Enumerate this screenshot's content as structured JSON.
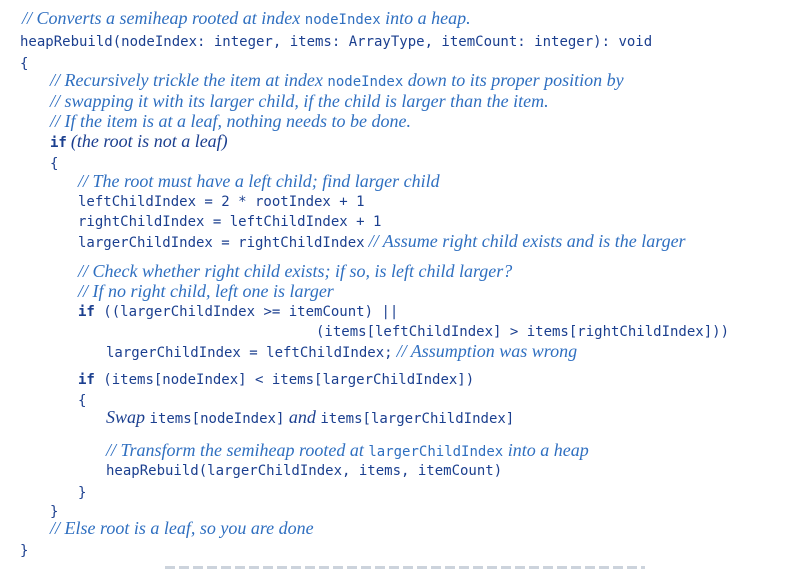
{
  "header_comment": "// Converts a semiheap rooted at index ",
  "header_comment_code": "nodeIndex",
  "header_comment_tail": " into a heap.",
  "signature": "heapRebuild(nodeIndex: integer, items: ArrayType, itemCount: integer): void",
  "open_brace_1": "{",
  "comment_trickle_a": "// Recursively trickle the item at index ",
  "comment_trickle_code": "nodeIndex",
  "comment_trickle_b": " down to its proper position by",
  "comment_swap": "// swapping it with its larger child, if the child is larger than the item.",
  "comment_leaf": "// If the item is at a leaf, nothing needs to be done.",
  "if_kw_1": "if",
  "if_cond_1": "(the root is not a leaf)",
  "open_brace_2": "{",
  "comment_left_child": "// The root must have a left child; find larger child",
  "stmt_left": "leftChildIndex = 2 * rootIndex + 1",
  "stmt_right": "rightChildIndex = leftChildIndex + 1",
  "stmt_larger": "largerChildIndex = rightChildIndex",
  "comment_assume": "// Assume right child exists and is the larger",
  "comment_check_a": "// Check whether right child exists; if so, is left child larger?",
  "comment_check_b": "// If no right child, left one is larger",
  "if_kw_2": "if",
  "if_cond_2a": "((largerChildIndex >= itemCount) ||",
  "if_cond_2b": "(items[leftChildIndex] > items[rightChildIndex]))",
  "stmt_larger_left": "largerChildIndex = leftChildIndex;",
  "comment_wrong": "// Assumption was wrong",
  "if_kw_3": "if",
  "if_cond_3": "(items[nodeIndex] < items[largerChildIndex])",
  "open_brace_3": "{",
  "swap_word": "Swap",
  "swap_code_1": "items[nodeIndex]",
  "swap_and": "and",
  "swap_code_2": "items[largerChildIndex]",
  "comment_transform_a": "// Transform the semiheap rooted at ",
  "comment_transform_code": "largerChildIndex",
  "comment_transform_b": " into a heap",
  "stmt_recursive": "heapRebuild(largerChildIndex, items, itemCount)",
  "close_brace_3": "}",
  "close_brace_2": "}",
  "comment_else": "// Else root is a leaf, so you are done",
  "close_brace_1": "}"
}
